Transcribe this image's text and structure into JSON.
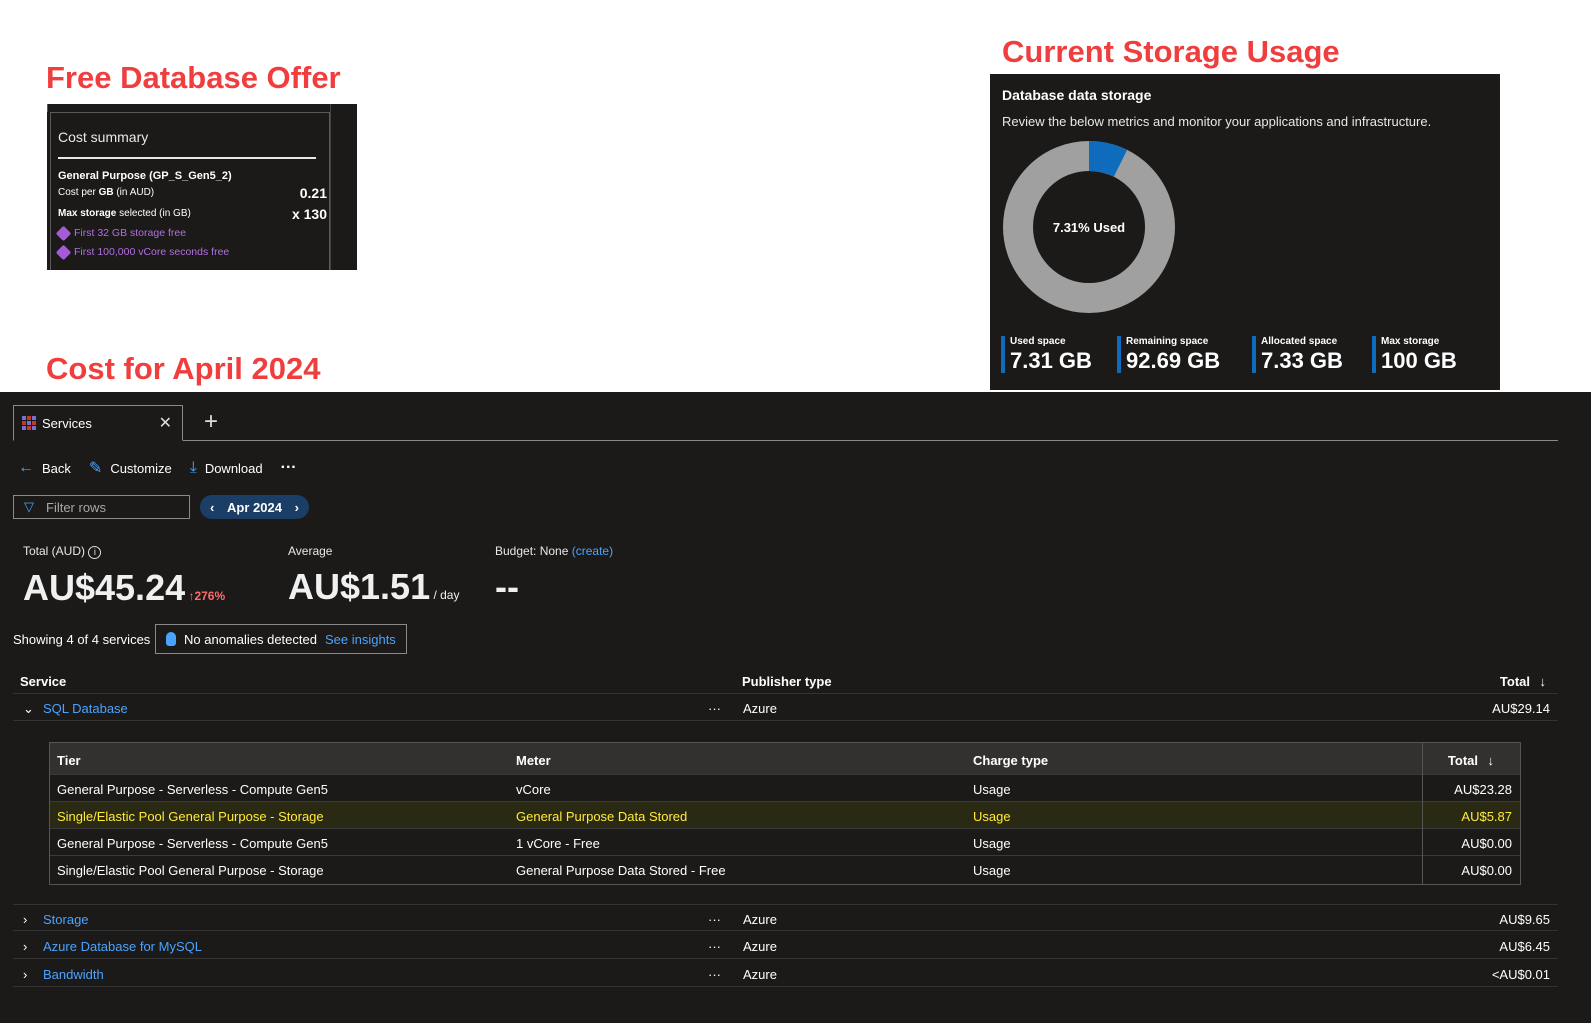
{
  "annotations": {
    "free_offer": "Free Database Offer",
    "storage_usage": "Current Storage Usage",
    "cost_month": "Cost for April 2024"
  },
  "offer": {
    "title": "Cost summary",
    "tier": "General Purpose (GP_S_Gen5_2)",
    "cost_per_gb_label_pre": "Cost per ",
    "cost_per_gb_label_bold": "GB",
    "cost_per_gb_label_post": " (in AUD)",
    "cost_per_gb_value": "0.21",
    "max_storage_label_bold": "Max storage",
    "max_storage_label_post": " selected (in GB)",
    "max_storage_value": "x 130",
    "free_items": [
      "First 32 GB storage free",
      "First 100,000 vCore seconds free"
    ]
  },
  "storage": {
    "heading": "Database data storage",
    "subheading": "Review the below metrics and monitor your applications and infrastructure.",
    "center_label": "7.31% Used",
    "used_fraction": 0.0731,
    "metrics": [
      {
        "label": "Used space",
        "value": "7.31 GB"
      },
      {
        "label": "Remaining space",
        "value": "92.69 GB"
      },
      {
        "label": "Allocated space",
        "value": "7.33 GB"
      },
      {
        "label": "Max storage",
        "value": "100 GB"
      }
    ],
    "colors": {
      "used": "#0f6cbd",
      "remaining": "#a0a0a0"
    }
  },
  "app": {
    "tab_label": "Services",
    "toolbar": {
      "back": "Back",
      "customize": "Customize",
      "download": "Download",
      "more": "···"
    },
    "filter_placeholder": "Filter rows",
    "period": "Apr 2024",
    "total_label": "Total (AUD)",
    "total_value": "AU$45.24",
    "total_change": "276%",
    "average_label": "Average",
    "average_value": "AU$1.51",
    "average_unit": "/ day",
    "budget_label": "Budget: None",
    "budget_link": "(create)",
    "budget_value": "--",
    "showing": "Showing 4 of 4 services",
    "anomalies": "No anomalies detected",
    "insights_link": "See insights",
    "columns": {
      "service": "Service",
      "publisher": "Publisher type",
      "total": "Total"
    },
    "services": [
      {
        "name": "SQL Database",
        "publisher": "Azure",
        "total": "AU$29.14",
        "expanded": true
      },
      {
        "name": "Storage",
        "publisher": "Azure",
        "total": "AU$9.65"
      },
      {
        "name": "Azure Database for MySQL",
        "publisher": "Azure",
        "total": "AU$6.45"
      },
      {
        "name": "Bandwidth",
        "publisher": "Azure",
        "total": "<AU$0.01"
      }
    ],
    "sub_columns": {
      "tier": "Tier",
      "meter": "Meter",
      "charge": "Charge type",
      "total": "Total"
    },
    "sub_rows": [
      {
        "tier": "General Purpose - Serverless - Compute Gen5",
        "meter": "vCore",
        "charge": "Usage",
        "total": "AU$23.28"
      },
      {
        "tier": "Single/Elastic Pool General Purpose - Storage",
        "meter": "General Purpose Data Stored",
        "charge": "Usage",
        "total": "AU$5.87"
      },
      {
        "tier": "General Purpose - Serverless - Compute Gen5",
        "meter": "1 vCore - Free",
        "charge": "Usage",
        "total": "AU$0.00"
      },
      {
        "tier": "Single/Elastic Pool General Purpose - Storage",
        "meter": "General Purpose Data Stored - Free",
        "charge": "Usage",
        "total": "AU$0.00"
      }
    ]
  }
}
